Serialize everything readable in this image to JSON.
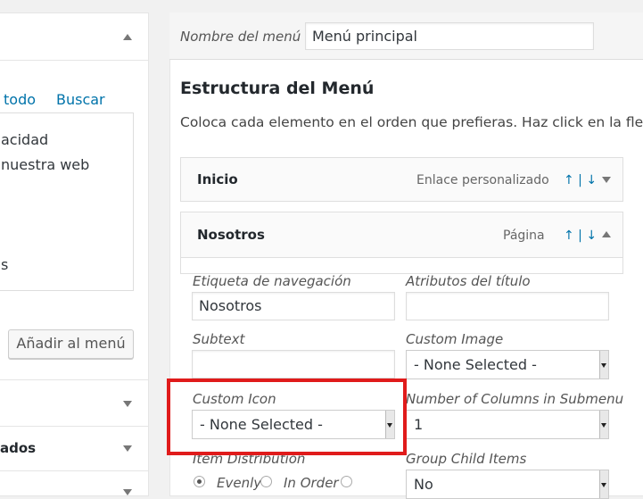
{
  "left": {
    "links": {
      "select_all": "todo",
      "search": "Buscar"
    },
    "list_items": [
      "acidad",
      "nuestra web",
      "s"
    ],
    "add_button": "Añadir al menú",
    "section_label": "ados"
  },
  "header": {
    "menu_name_label": "Nombre del menú",
    "menu_name_value": "Menú principal"
  },
  "structure": {
    "title": "Estructura del Menú",
    "description": "Coloca cada elemento en el orden que prefieras. Haz click en la flecha"
  },
  "items": [
    {
      "title": "Inicio",
      "type": "Enlace personalizado",
      "ctrl": "↑ | ↓"
    },
    {
      "title": "Nosotros",
      "type": "Página",
      "ctrl": "↑ | ↓"
    }
  ],
  "fields": {
    "nav_label": {
      "label": "Etiqueta de navegación",
      "value": "Nosotros"
    },
    "title_attr": {
      "label": "Atributos del título",
      "value": ""
    },
    "subtext": {
      "label": "Subtext",
      "value": ""
    },
    "custom_image": {
      "label": "Custom Image",
      "value": "- None Selected -"
    },
    "custom_icon": {
      "label": "Custom Icon",
      "value": "- None Selected -"
    },
    "num_columns": {
      "label": "Number of Columns in Submenu",
      "value": "1"
    },
    "item_distribution": {
      "label": "Item Distribution",
      "options": [
        "Evenly",
        "In Order"
      ],
      "selected": "Evenly"
    },
    "group_child": {
      "label": "Group Child Items",
      "value": "No"
    }
  },
  "colors": {
    "accent": "#0073aa",
    "highlight": "#e01b1b"
  }
}
